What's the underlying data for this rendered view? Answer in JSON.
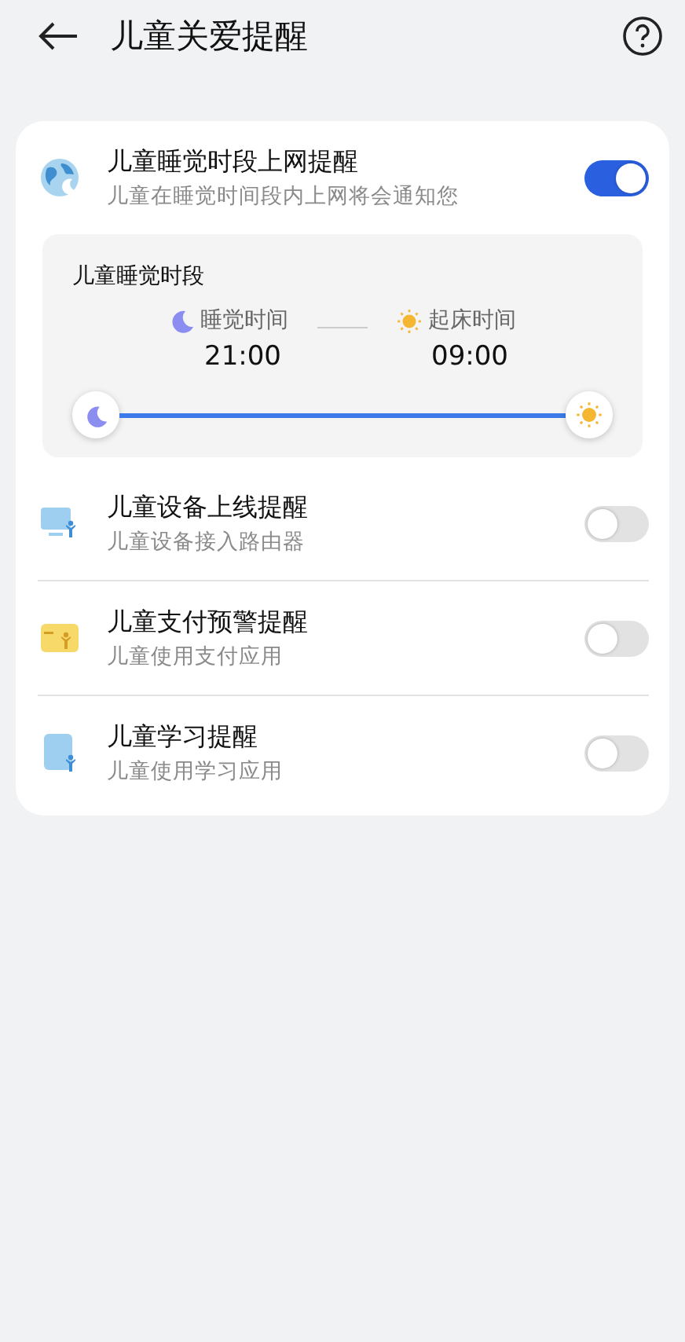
{
  "header": {
    "title": "儿童关爱提醒"
  },
  "items": [
    {
      "title": "儿童睡觉时段上网提醒",
      "subtitle": "儿童在睡觉时间段内上网将会通知您",
      "on": true,
      "panel": {
        "title": "儿童睡觉时段",
        "start_label": "睡觉时间",
        "start_time": "21:00",
        "end_label": "起床时间",
        "end_time": "09:00"
      }
    },
    {
      "title": "儿童设备上线提醒",
      "subtitle": "儿童设备接入路由器",
      "on": false
    },
    {
      "title": "儿童支付预警提醒",
      "subtitle": "儿童使用支付应用",
      "on": false
    },
    {
      "title": "儿童学习提醒",
      "subtitle": "儿童使用学习应用",
      "on": false
    }
  ]
}
